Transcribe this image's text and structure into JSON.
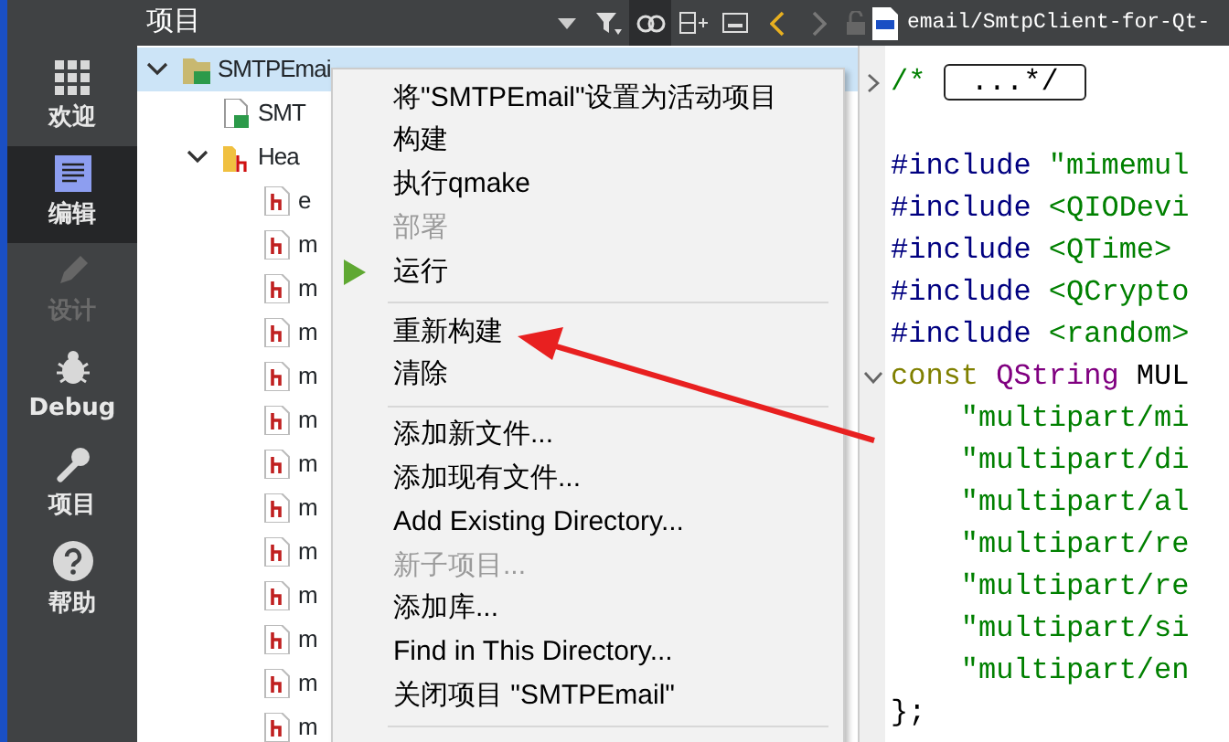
{
  "sidebar": {
    "items": [
      {
        "label": "欢迎",
        "selected": false,
        "disabled": false
      },
      {
        "label": "编辑",
        "selected": true,
        "disabled": false
      },
      {
        "label": "设计",
        "selected": false,
        "disabled": true
      },
      {
        "label": "Debug",
        "selected": false,
        "disabled": false
      },
      {
        "label": "项目",
        "selected": false,
        "disabled": false
      },
      {
        "label": "帮助",
        "selected": false,
        "disabled": false
      }
    ]
  },
  "project_panel": {
    "title": "项目",
    "tree": [
      {
        "label": "SMTPEmai",
        "kind": "project",
        "selected": true,
        "expanded": true,
        "children": [
          {
            "label": "SMT",
            "kind": "file"
          },
          {
            "label": "Hea",
            "kind": "folder",
            "expanded": true,
            "children": [
              {
                "label": "e",
                "kind": "header"
              },
              {
                "label": "m",
                "kind": "header"
              },
              {
                "label": "m",
                "kind": "header"
              },
              {
                "label": "m",
                "kind": "header"
              },
              {
                "label": "m",
                "kind": "header"
              },
              {
                "label": "m",
                "kind": "header"
              },
              {
                "label": "m",
                "kind": "header"
              },
              {
                "label": "m",
                "kind": "header"
              },
              {
                "label": "m",
                "kind": "header"
              },
              {
                "label": "m",
                "kind": "header"
              },
              {
                "label": "m",
                "kind": "header"
              },
              {
                "label": "m",
                "kind": "header"
              },
              {
                "label": "m",
                "kind": "header"
              }
            ]
          }
        ]
      }
    ]
  },
  "editor": {
    "tab_title": "email/SmtpClient-for-Qt-",
    "lines": [
      {
        "folded": true,
        "tokens": [
          {
            "kind": "comment",
            "text": "/* "
          },
          {
            "kind": "folded",
            "text": "...*/"
          }
        ]
      },
      {
        "kind": "blank"
      },
      {
        "tokens": [
          {
            "kind": "preproc",
            "text": "#include "
          },
          {
            "kind": "string",
            "text": "\"mimemul"
          }
        ]
      },
      {
        "tokens": [
          {
            "kind": "preproc",
            "text": "#include "
          },
          {
            "kind": "string",
            "text": "<QIODevi"
          }
        ]
      },
      {
        "tokens": [
          {
            "kind": "preproc",
            "text": "#include "
          },
          {
            "kind": "string",
            "text": "<QTime>"
          }
        ]
      },
      {
        "tokens": [
          {
            "kind": "preproc",
            "text": "#include "
          },
          {
            "kind": "string",
            "text": "<QCrypto"
          }
        ]
      },
      {
        "tokens": [
          {
            "kind": "preproc",
            "text": "#include "
          },
          {
            "kind": "string",
            "text": "<random>"
          }
        ]
      },
      {
        "folded": false,
        "tokens": [
          {
            "kind": "keyword",
            "text": "const "
          },
          {
            "kind": "type",
            "text": "QString "
          },
          {
            "kind": "plain",
            "text": "MUL"
          }
        ]
      },
      {
        "tokens": [
          {
            "kind": "string",
            "text": "    \"multipart/mi"
          }
        ]
      },
      {
        "tokens": [
          {
            "kind": "string",
            "text": "    \"multipart/di"
          }
        ]
      },
      {
        "tokens": [
          {
            "kind": "string",
            "text": "    \"multipart/al"
          }
        ]
      },
      {
        "tokens": [
          {
            "kind": "string",
            "text": "    \"multipart/re"
          }
        ]
      },
      {
        "tokens": [
          {
            "kind": "string",
            "text": "    \"multipart/re"
          }
        ]
      },
      {
        "tokens": [
          {
            "kind": "string",
            "text": "    \"multipart/si"
          }
        ]
      },
      {
        "tokens": [
          {
            "kind": "string",
            "text": "    \"multipart/en"
          }
        ]
      },
      {
        "tokens": [
          {
            "kind": "plain",
            "text": "};"
          }
        ]
      }
    ]
  },
  "context_menu": {
    "items": [
      {
        "kind": "item",
        "label": "将\"SMTPEmail\"设置为活动项目",
        "disabled": false
      },
      {
        "kind": "item",
        "label": "构建",
        "disabled": false
      },
      {
        "kind": "item",
        "label": "执行qmake",
        "disabled": false
      },
      {
        "kind": "item",
        "label": "部署",
        "disabled": true
      },
      {
        "kind": "run",
        "label": "运行",
        "disabled": false
      },
      {
        "kind": "separator"
      },
      {
        "kind": "item",
        "label": "重新构建",
        "disabled": false
      },
      {
        "kind": "item",
        "label": "清除",
        "disabled": false
      },
      {
        "kind": "separator"
      },
      {
        "kind": "item",
        "label": "添加新文件...",
        "disabled": false
      },
      {
        "kind": "item",
        "label": "添加现有文件...",
        "disabled": false
      },
      {
        "kind": "item",
        "label": "Add Existing Directory...",
        "disabled": false
      },
      {
        "kind": "item",
        "label": "新子项目...",
        "disabled": true
      },
      {
        "kind": "item",
        "label": "添加库...",
        "disabled": false
      },
      {
        "kind": "item",
        "label": "Find in This Directory...",
        "disabled": false
      },
      {
        "kind": "item",
        "label": "关闭项目 \"SMTPEmail\"",
        "disabled": false
      },
      {
        "kind": "separator"
      }
    ]
  }
}
